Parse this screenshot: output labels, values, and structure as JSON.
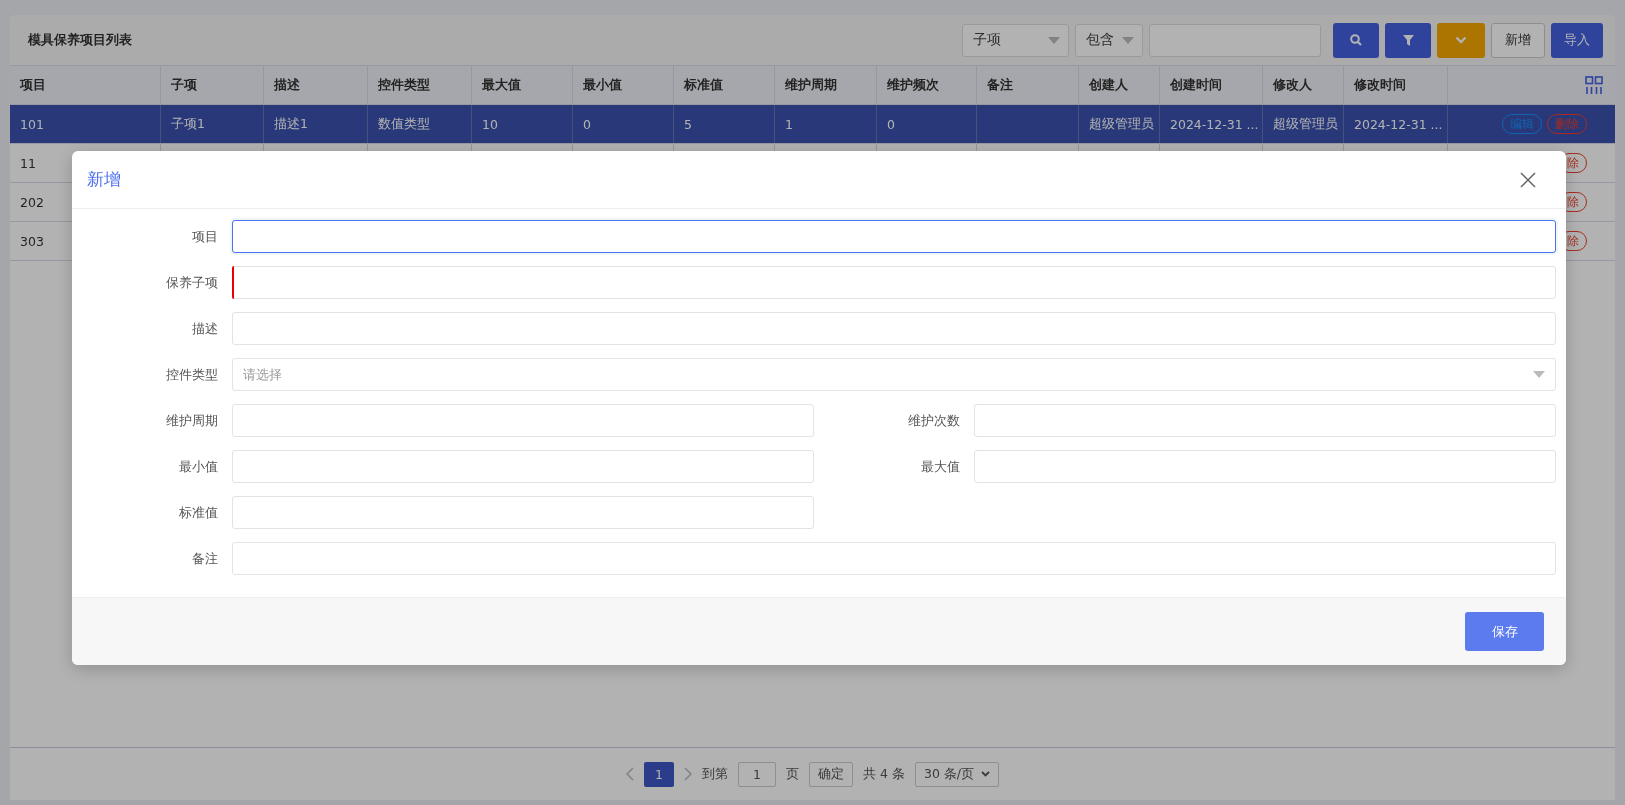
{
  "page": {
    "title": "模具保养项目列表"
  },
  "toolbar": {
    "field_select": "子项",
    "operator_select": "包含",
    "buttons": [
      {
        "kind": "search"
      },
      {
        "kind": "filter"
      },
      {
        "kind": "expand"
      },
      {
        "kind": "text",
        "label": "新增"
      },
      {
        "kind": "primary",
        "label": "导入"
      }
    ]
  },
  "table": {
    "columns": [
      "项目",
      "子项",
      "描述",
      "控件类型",
      "最大值",
      "最小值",
      "标准值",
      "维护周期",
      "维护频次",
      "备注",
      "创建人",
      "创建时间",
      "修改人",
      "修改时间"
    ],
    "rows": [
      {
        "selected": true,
        "cells": [
          "101",
          "子项1",
          "描述1",
          "数值类型",
          "10",
          "0",
          "5",
          "1",
          "0",
          "",
          "超级管理员",
          "2024-12-31 ...",
          "超级管理员",
          "2024-12-31 ..."
        ],
        "actions": [
          {
            "kind": "edit",
            "label": "编辑"
          },
          {
            "kind": "delete",
            "label": "删除"
          }
        ]
      },
      {
        "selected": false,
        "cells": [
          "11"
        ],
        "actions": [
          {
            "kind": "delete",
            "label": "除"
          }
        ]
      },
      {
        "selected": false,
        "cells": [
          "202"
        ],
        "actions": [
          {
            "kind": "delete",
            "label": "除"
          }
        ]
      },
      {
        "selected": false,
        "cells": [
          "303"
        ],
        "actions": [
          {
            "kind": "delete",
            "label": "除"
          }
        ]
      }
    ]
  },
  "pager": {
    "pages": [
      {
        "label": "1",
        "selected": true
      }
    ],
    "goto_label": "到第",
    "goto_value": "1",
    "page_unit": "页",
    "confirm": "确定",
    "total": "共 4 条",
    "page_size": "30 条/页"
  },
  "dialog": {
    "title": "新增",
    "fields": [
      {
        "label": "项目",
        "kind": "text",
        "wide": true,
        "focused": true,
        "invalid": false
      },
      {
        "label": "保养子项",
        "kind": "text",
        "wide": true,
        "focused": false,
        "invalid": true
      },
      {
        "label": "描述",
        "kind": "text",
        "wide": true,
        "focused": false,
        "invalid": false
      },
      {
        "label": "控件类型",
        "kind": "select",
        "placeholder": "请选择",
        "wide": true,
        "focused": false,
        "invalid": false
      },
      {
        "label": "维护周期",
        "kind": "text",
        "wide": false,
        "focused": false,
        "invalid": false
      },
      {
        "label": "维护次数",
        "kind": "text",
        "wide": false,
        "focused": false,
        "invalid": false
      },
      {
        "label": "最小值",
        "kind": "text",
        "wide": false,
        "focused": false,
        "invalid": false
      },
      {
        "label": "最大值",
        "kind": "text",
        "wide": false,
        "focused": false,
        "invalid": false
      },
      {
        "label": "标准值",
        "kind": "text",
        "wide": false,
        "focused": false,
        "invalid": false
      },
      {
        "label": "备注",
        "kind": "text",
        "wide": true,
        "focused": false,
        "invalid": false
      }
    ],
    "save": "保存"
  }
}
